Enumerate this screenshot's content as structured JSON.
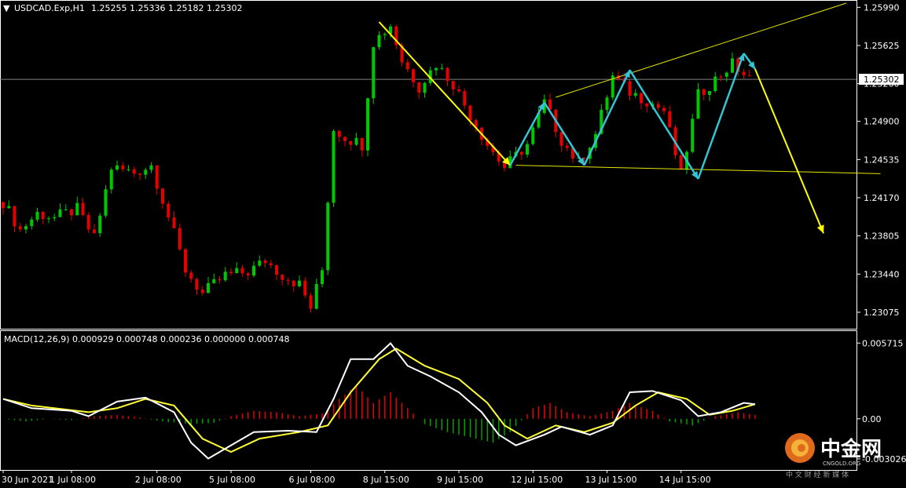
{
  "header": {
    "symbol_label": "USDCAD.Exp,H1",
    "ohlc": "1.25255 1.25336 1.25182 1.25302",
    "macd_label": "MACD(12,26,9) 0.000929 0.000748 0.000236 0.000000 0.000748"
  },
  "colors": {
    "background": "#000000",
    "frame": "#ffffff",
    "bull_candle": "#00c800",
    "bear_candle": "#e60000",
    "current_price_line": "#808080",
    "trendline": "#e6e600",
    "projection_arrow": "#ffff00",
    "zigzag": "#33c5d6",
    "macd_main": "#ffffff",
    "macd_signal": "#ffff33",
    "hist_pos": "#e60000",
    "hist_neg": "#00a000"
  },
  "watermark": {
    "brand": "中金网",
    "site": "CNGOLD.ORG",
    "slogan": "中 文 财 经 新 媒 体",
    "icon": "cngold-logo-icon"
  },
  "chart_data": [
    {
      "type": "candlestick",
      "name": "price",
      "current_price": 1.25302,
      "current_price_label": "1.25302",
      "y_ticks": [
        1.2599,
        1.25625,
        1.2526,
        1.249,
        1.24535,
        1.2417,
        1.23805,
        1.2344,
        1.23075
      ],
      "y_tick_labels": [
        "1.25990",
        "1.25625",
        "1.25260",
        "1.24900",
        "1.24535",
        "1.24170",
        "1.23805",
        "1.23440",
        "1.23075"
      ],
      "ylim": [
        1.2294,
        1.2603
      ],
      "x_tick_labels": [
        "30 Jun 2021",
        "1 Jul 08:00",
        "2 Jul 08:00",
        "5 Jul 08:00",
        "6 Jul 08:00",
        "8 Jul 15:00",
        "9 Jul 15:00",
        "12 Jul 15:00",
        "13 Jul 15:00",
        "14 Jul 15:00"
      ],
      "x_tick_index": [
        0,
        12,
        27,
        40,
        54,
        67,
        80,
        93,
        106,
        119
      ],
      "close_path": [
        [
          0,
          1.2413
        ],
        [
          3,
          1.2386
        ],
        [
          6,
          1.2402
        ],
        [
          9,
          1.2398
        ],
        [
          13,
          1.2406
        ],
        [
          16,
          1.2378
        ],
        [
          19,
          1.2446
        ],
        [
          23,
          1.2441
        ],
        [
          26,
          1.2448
        ],
        [
          29,
          1.2399
        ],
        [
          32,
          1.2348
        ],
        [
          35,
          1.2325
        ],
        [
          39,
          1.2343
        ],
        [
          43,
          1.2346
        ],
        [
          46,
          1.2357
        ],
        [
          49,
          1.2343
        ],
        [
          52,
          1.2334
        ],
        [
          54,
          1.2312
        ],
        [
          56,
          1.2348
        ],
        [
          58,
          1.2483
        ],
        [
          60,
          1.2475
        ],
        [
          63,
          1.2468
        ],
        [
          65,
          1.2566
        ],
        [
          68,
          1.2582
        ],
        [
          70,
          1.2548
        ],
        [
          73,
          1.2523
        ],
        [
          76,
          1.2545
        ],
        [
          79,
          1.2526
        ],
        [
          82,
          1.2496
        ],
        [
          85,
          1.2468
        ],
        [
          88,
          1.2446
        ],
        [
          92,
          1.2468
        ],
        [
          95,
          1.2508
        ],
        [
          98,
          1.2472
        ],
        [
          101,
          1.245
        ],
        [
          104,
          1.2478
        ],
        [
          107,
          1.2533
        ],
        [
          110,
          1.2518
        ],
        [
          113,
          1.251
        ],
        [
          116,
          1.25
        ],
        [
          119,
          1.2438
        ],
        [
          122,
          1.2515
        ],
        [
          125,
          1.253
        ],
        [
          128,
          1.2545
        ],
        [
          131,
          1.253
        ]
      ],
      "trendlines": [
        {
          "from": [
            66,
            1.2585
          ],
          "to": [
            89,
            1.2448
          ],
          "kind": "arrow",
          "color_key": "projection_arrow"
        },
        {
          "from": [
            90,
            1.2448
          ],
          "to": [
            154,
            1.244
          ],
          "kind": "line",
          "color_key": "trendline"
        },
        {
          "from": [
            97,
            1.2513
          ],
          "to": [
            148,
            1.2603
          ],
          "kind": "line",
          "color_key": "trendline"
        },
        {
          "from": [
            132,
            1.254
          ],
          "to": [
            144,
            1.2383
          ],
          "kind": "arrow",
          "color_key": "projection_arrow"
        }
      ],
      "zigzag": [
        [
          89,
          1.2448
        ],
        [
          95,
          1.2508
        ],
        [
          102,
          1.2448
        ],
        [
          110,
          1.2539
        ],
        [
          122,
          1.2435
        ],
        [
          130,
          1.2555
        ],
        [
          132,
          1.254
        ]
      ]
    },
    {
      "type": "macd",
      "name": "MACD(12,26,9)",
      "y_tick_labels": [
        "0.005715",
        "0.00",
        "-0.003026"
      ],
      "y_ticks": [
        0.005715,
        0.0,
        -0.003026
      ],
      "ylim": [
        -0.0038,
        0.0065
      ],
      "main": [
        [
          0,
          0.0015
        ],
        [
          5,
          0.0008
        ],
        [
          12,
          0.0006
        ],
        [
          15,
          0.0002
        ],
        [
          20,
          0.0013
        ],
        [
          25,
          0.0016
        ],
        [
          30,
          0.0005
        ],
        [
          33,
          -0.0018
        ],
        [
          36,
          -0.003
        ],
        [
          40,
          -0.002
        ],
        [
          44,
          -0.001
        ],
        [
          50,
          -0.0009
        ],
        [
          55,
          -0.001
        ],
        [
          58,
          0.0015
        ],
        [
          61,
          0.0045
        ],
        [
          65,
          0.0045
        ],
        [
          68,
          0.0057
        ],
        [
          71,
          0.004
        ],
        [
          75,
          0.0032
        ],
        [
          80,
          0.002
        ],
        [
          84,
          0.0005
        ],
        [
          87,
          -0.0012
        ],
        [
          90,
          -0.002
        ],
        [
          95,
          -0.0012
        ],
        [
          98,
          -0.0006
        ],
        [
          103,
          -0.0012
        ],
        [
          107,
          -0.0005
        ],
        [
          110,
          0.002
        ],
        [
          114,
          0.0021
        ],
        [
          119,
          0.0014
        ],
        [
          122,
          0.0002
        ],
        [
          126,
          0.0005
        ],
        [
          130,
          0.0012
        ],
        [
          132,
          0.0011
        ]
      ],
      "signal": [
        [
          0,
          0.0015
        ],
        [
          5,
          0.001
        ],
        [
          15,
          0.0005
        ],
        [
          20,
          0.0008
        ],
        [
          25,
          0.0015
        ],
        [
          30,
          0.001
        ],
        [
          35,
          -0.0015
        ],
        [
          40,
          -0.0025
        ],
        [
          45,
          -0.0015
        ],
        [
          52,
          -0.001
        ],
        [
          57,
          -0.0005
        ],
        [
          61,
          0.002
        ],
        [
          66,
          0.0045
        ],
        [
          69,
          0.0053
        ],
        [
          74,
          0.004
        ],
        [
          80,
          0.003
        ],
        [
          85,
          0.0012
        ],
        [
          88,
          -0.0005
        ],
        [
          92,
          -0.0015
        ],
        [
          97,
          -0.0005
        ],
        [
          102,
          -0.001
        ],
        [
          107,
          -0.0003
        ],
        [
          111,
          0.001
        ],
        [
          115,
          0.002
        ],
        [
          120,
          0.0015
        ],
        [
          124,
          0.0003
        ],
        [
          128,
          0.0006
        ],
        [
          132,
          0.0011
        ]
      ],
      "histogram": [
        [
          0,
          0.0
        ],
        [
          4,
          -0.0002
        ],
        [
          8,
          0.0
        ],
        [
          12,
          -0.0001
        ],
        [
          16,
          0.0002
        ],
        [
          20,
          0.0003
        ],
        [
          24,
          0.0001
        ],
        [
          28,
          -0.0002
        ],
        [
          33,
          -0.0004
        ],
        [
          37,
          -0.0003
        ],
        [
          40,
          0.0002
        ],
        [
          44,
          0.0006
        ],
        [
          48,
          0.0005
        ],
        [
          52,
          0.0002
        ],
        [
          56,
          0.0004
        ],
        [
          59,
          0.0015
        ],
        [
          62,
          0.0025
        ],
        [
          65,
          0.0012
        ],
        [
          68,
          0.002
        ],
        [
          71,
          0.0008
        ],
        [
          74,
          -0.0004
        ],
        [
          78,
          -0.001
        ],
        [
          82,
          -0.0014
        ],
        [
          86,
          -0.0018
        ],
        [
          89,
          -0.001
        ],
        [
          93,
          0.0008
        ],
        [
          96,
          0.0012
        ],
        [
          99,
          0.0005
        ],
        [
          103,
          0.0002
        ],
        [
          107,
          0.0006
        ],
        [
          110,
          0.0012
        ],
        [
          114,
          0.0006
        ],
        [
          117,
          -0.0002
        ],
        [
          121,
          -0.0005
        ],
        [
          125,
          0.0002
        ],
        [
          129,
          0.0005
        ],
        [
          132,
          0.0003
        ]
      ]
    }
  ]
}
